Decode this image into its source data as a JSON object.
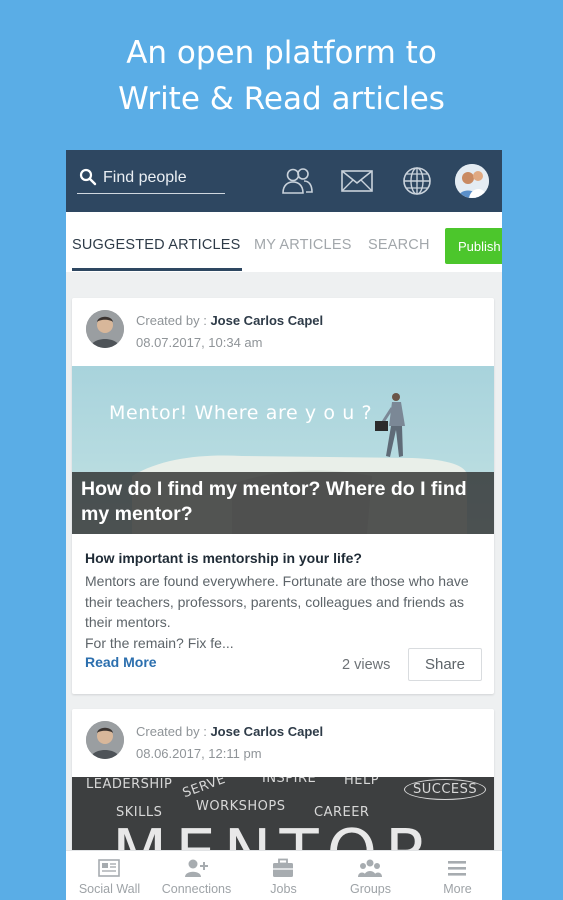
{
  "promo": {
    "line1": "An open platform to",
    "line2": "Write & Read articles"
  },
  "header": {
    "search_placeholder": "Find people",
    "icons": [
      "search-icon",
      "connections-icon",
      "messages-icon",
      "globe-icon",
      "profile-avatar"
    ]
  },
  "tabs": {
    "items": [
      {
        "label": "SUGGESTED ARTICLES",
        "active": true
      },
      {
        "label": "MY ARTICLES",
        "active": false
      },
      {
        "label": "SEARCH",
        "active": false
      }
    ],
    "publish_label": "Publish"
  },
  "articles": [
    {
      "created_prefix": "Created by : ",
      "author": "Jose Carlos Capel",
      "date": "08.07.2017, 10:34 am",
      "image_text": "Mentor! Where are y o u ?",
      "title": "How do I find my mentor? Where do I find my mentor?",
      "subheading": "How important is mentorship in your life?",
      "excerpt": "Mentors are found everywhere. Fortunate are those who have their teachers, professors, parents, colleagues and friends as their mentors.",
      "excerpt_more": "For the remain? Fix fe...",
      "read_more": "Read More",
      "views": "2 views",
      "share": "Share"
    },
    {
      "created_prefix": "Created by : ",
      "author": "Jose Carlos Capel",
      "date": "08.06.2017, 12:11 pm",
      "image_words": [
        "LEADERSHIP",
        "SERVE",
        "INSPIRE",
        "HELP",
        "SUCCESS",
        "SKILLS",
        "WORKSHOPS",
        "CAREER",
        "MENTOR"
      ]
    }
  ],
  "bottom_nav": [
    {
      "label": "Social Wall",
      "icon": "social-wall-icon"
    },
    {
      "label": "Connections",
      "icon": "add-connection-icon"
    },
    {
      "label": "Jobs",
      "icon": "briefcase-icon"
    },
    {
      "label": "Groups",
      "icon": "groups-icon"
    },
    {
      "label": "More",
      "icon": "menu-icon"
    }
  ],
  "colors": {
    "background": "#5aade6",
    "topbar": "#2e4761",
    "publish": "#4cc62c",
    "link": "#2c6fae"
  }
}
